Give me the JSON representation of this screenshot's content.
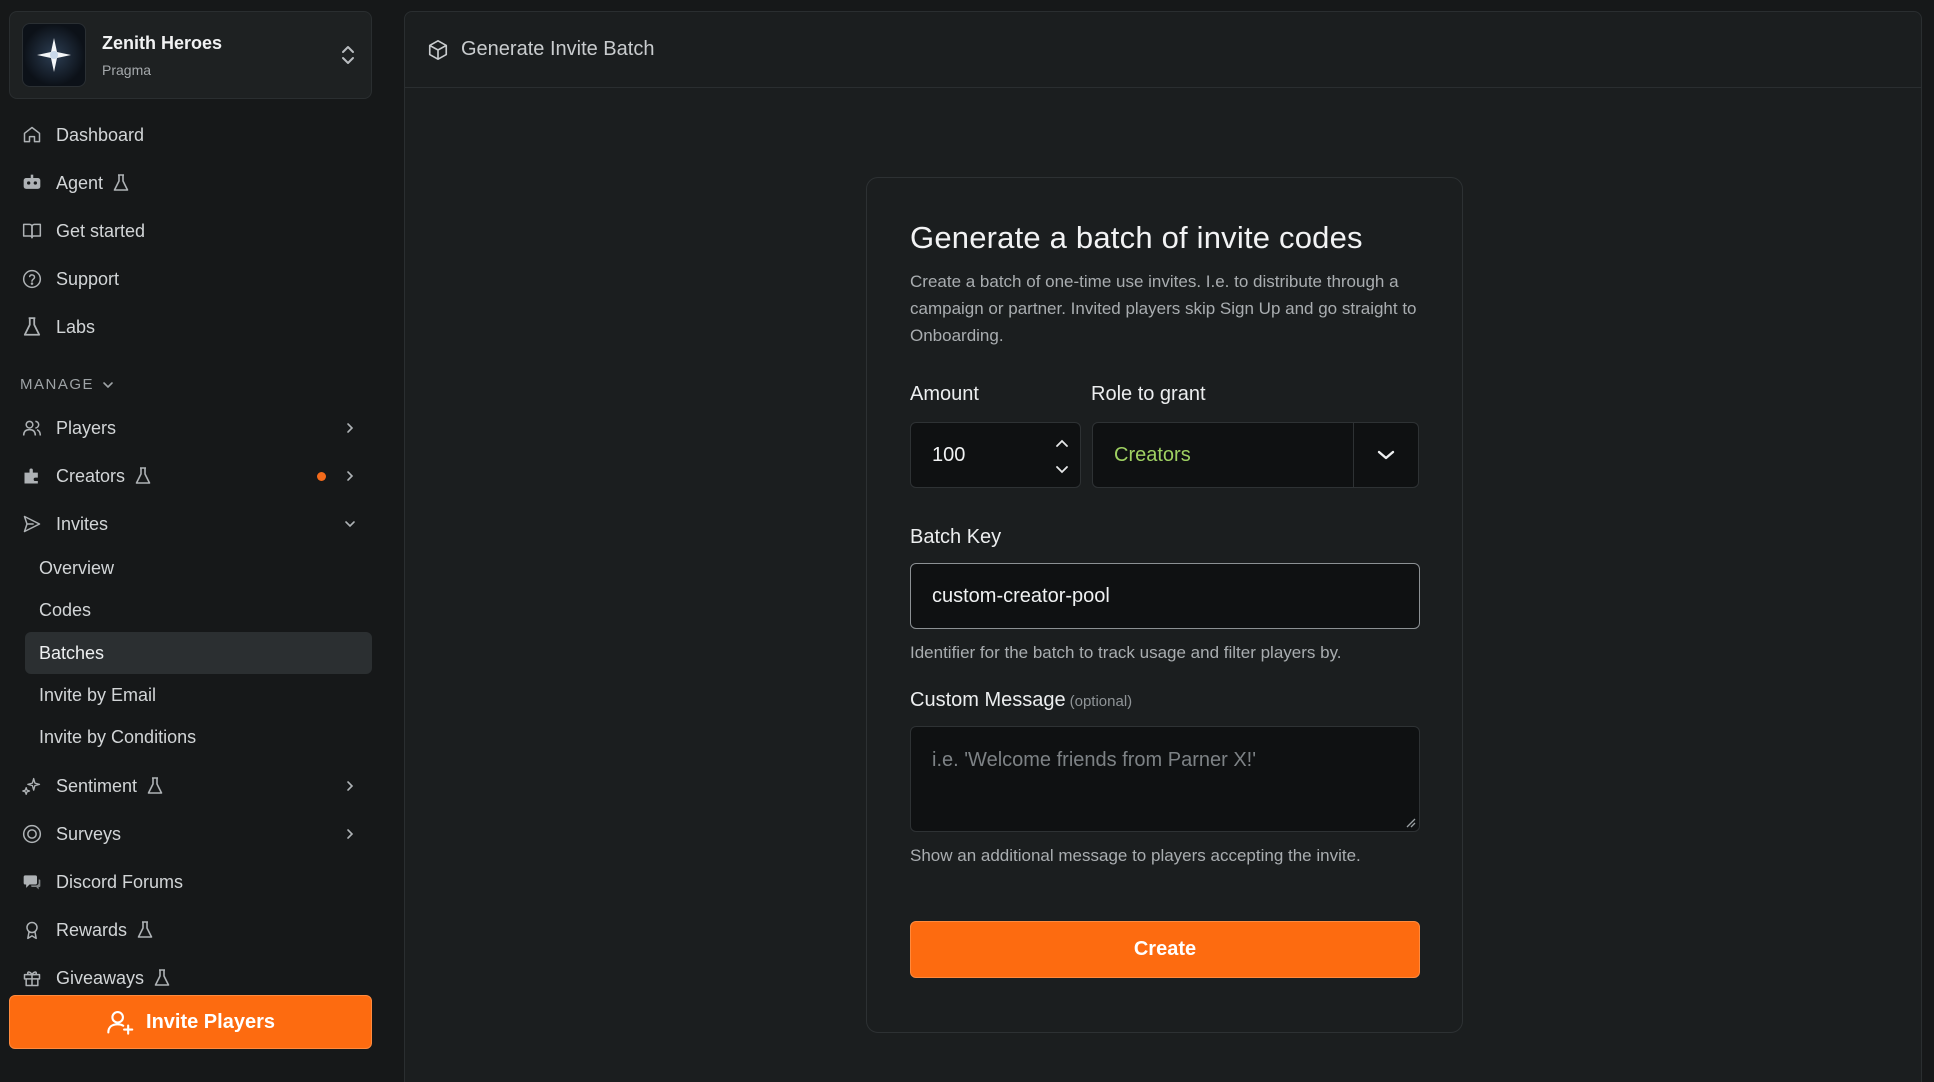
{
  "workspace": {
    "name": "Zenith Heroes",
    "subtitle": "Pragma"
  },
  "nav": {
    "primary": [
      {
        "label": "Dashboard",
        "icon": "home-icon"
      },
      {
        "label": "Agent",
        "icon": "agent-icon",
        "beta": true
      },
      {
        "label": "Get started",
        "icon": "book-icon"
      },
      {
        "label": "Support",
        "icon": "help-circle-icon"
      },
      {
        "label": "Labs",
        "icon": "flask-icon"
      }
    ],
    "section_label": "MANAGE",
    "manage": [
      {
        "label": "Players",
        "icon": "users-icon"
      },
      {
        "label": "Creators",
        "icon": "puzzle-icon",
        "beta": true,
        "notification": true
      },
      {
        "label": "Invites",
        "icon": "send-icon",
        "expanded": true
      },
      {
        "label": "Sentiment",
        "icon": "sparkles-icon",
        "beta": true
      },
      {
        "label": "Surveys",
        "icon": "survey-icon"
      },
      {
        "label": "Discord Forums",
        "icon": "discord-icon"
      },
      {
        "label": "Rewards",
        "icon": "award-icon",
        "beta": true
      },
      {
        "label": "Giveaways",
        "icon": "gift-icon",
        "beta": true
      }
    ],
    "invites_sub": [
      "Overview",
      "Codes",
      "Batches",
      "Invite by Email",
      "Invite by Conditions"
    ],
    "active_sub": "Batches"
  },
  "invite_button": {
    "label": "Invite Players"
  },
  "header": {
    "title": "Generate Invite Batch"
  },
  "form": {
    "title": "Generate a batch of invite codes",
    "description": "Create a batch of one-time use invites. I.e. to distribute through a campaign or partner. Invited players skip Sign Up and go straight to Onboarding.",
    "amount_label": "Amount",
    "amount_value": "100",
    "role_label": "Role to grant",
    "role_value": "Creators",
    "batch_key_label": "Batch Key",
    "batch_key_value": "custom-creator-pool",
    "batch_key_help": "Identifier for the batch to track usage and filter players by.",
    "message_label": "Custom Message",
    "message_optional": "(optional)",
    "message_placeholder": "i.e. 'Welcome friends from Parner X!'",
    "message_help": "Show an additional message to players accepting the invite.",
    "submit_label": "Create"
  },
  "colors": {
    "accent": "#fd6b10",
    "role_value": "#9fd162",
    "notification_dot": "#f26a1b"
  }
}
